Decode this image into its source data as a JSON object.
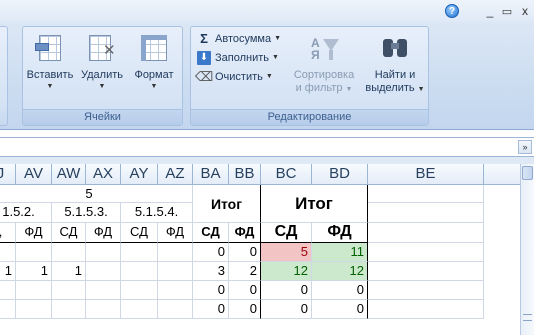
{
  "ribbon": {
    "cells_group": {
      "title": "Ячейки",
      "insert_label": "Вставить",
      "delete_label": "Удалить",
      "format_label": "Формат"
    },
    "edit_group": {
      "title": "Редактирование",
      "autosum_label": "Автосумма",
      "autosum_symbol": "Σ",
      "fill_label": "Заполнить",
      "clear_label": "Очистить",
      "sort_filter_line1": "Сортировка",
      "sort_filter_line2": "и фильтр",
      "find_select_line1": "Найти и",
      "find_select_line2": "выделить"
    }
  },
  "window": {
    "help_symbol": "?",
    "minimize_symbol": "_",
    "restore_symbol": "▭",
    "close_symbol": "x"
  },
  "sheet": {
    "columns": [
      "J",
      "AV",
      "AW",
      "AX",
      "AY",
      "AZ",
      "BA",
      "BB",
      "BC",
      "BD",
      "BE"
    ],
    "row_group_number": "5",
    "sub_headers": [
      "1.5.2.",
      "5.1.5.3.",
      "5.1.5.4."
    ],
    "itog_small": "Итог",
    "itog_big": "Итог",
    "sd_fd_labels": [
      "СД",
      "ФД",
      "СД",
      "ФД",
      "СД",
      "ФД"
    ],
    "left_partial": ",",
    "sd_bold": "СД",
    "fd_bold": "ФД",
    "rows": [
      {
        "j": "",
        "av": "",
        "aw": "",
        "ba": "0",
        "bb": "0",
        "bc": "5",
        "bd": "11"
      },
      {
        "j": "1",
        "av": "1",
        "aw": "1",
        "ba": "3",
        "bb": "2",
        "bc": "12",
        "bd": "12"
      },
      {
        "j": "",
        "av": "",
        "aw": "",
        "ba": "0",
        "bb": "0",
        "bc": "0",
        "bd": "0"
      },
      {
        "j": "",
        "av": "",
        "aw": "",
        "ba": "0",
        "bb": "0",
        "bc": "0",
        "bd": "0"
      }
    ]
  },
  "colors": {
    "pink_fill": "#f2c4c4",
    "green_fill": "#cde9cd",
    "ribbon_bg": "#c9dbf0"
  }
}
